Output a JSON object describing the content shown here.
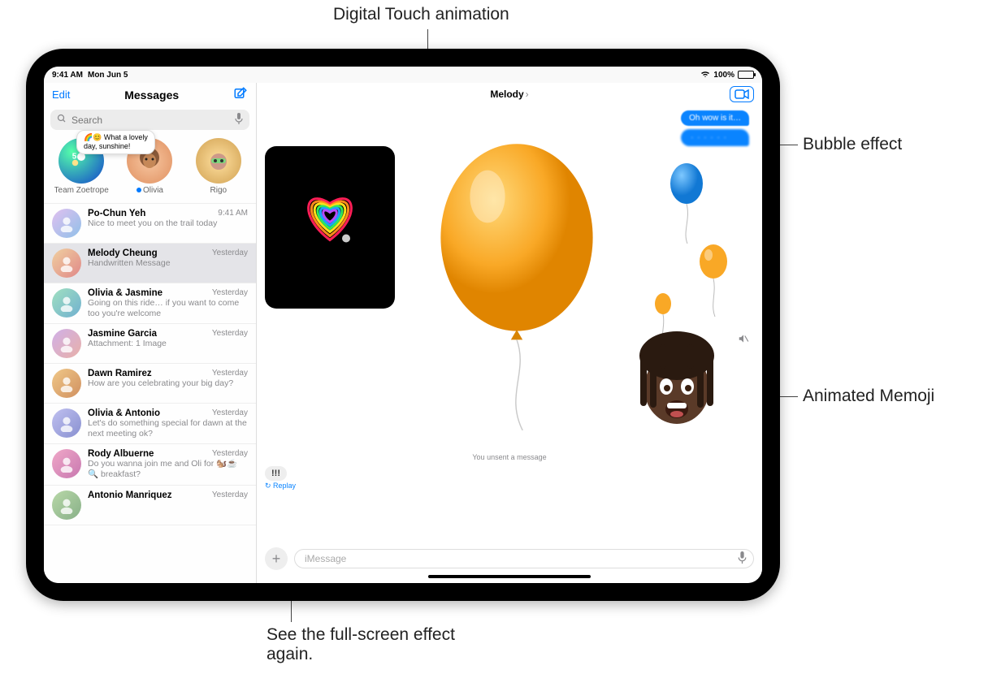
{
  "annotations": {
    "digital_touch": "Digital Touch animation",
    "bubble_effect": "Bubble effect",
    "animated_memoji": "Animated Memoji",
    "replay_hint": "See the full-screen effect again."
  },
  "statusbar": {
    "time": "9:41 AM",
    "date": "Mon Jun 5",
    "battery": "100%"
  },
  "sidebar": {
    "edit": "Edit",
    "title": "Messages",
    "search_placeholder": "Search",
    "tooltip_line1": "🌈😊 What a lovely",
    "tooltip_line2": "day, sunshine!",
    "pinned": [
      {
        "name": "Team Zoetrope"
      },
      {
        "name": "Olivia",
        "unread": true
      },
      {
        "name": "Rigo"
      }
    ],
    "conversations": [
      {
        "name": "Po-Chun Yeh",
        "time": "9:41 AM",
        "preview": "Nice to meet you on the trail today"
      },
      {
        "name": "Melody Cheung",
        "time": "Yesterday",
        "preview": "Handwritten Message",
        "selected": true
      },
      {
        "name": "Olivia & Jasmine",
        "time": "Yesterday",
        "preview": "Going on this ride… if you want to come too you're welcome"
      },
      {
        "name": "Jasmine Garcia",
        "time": "Yesterday",
        "preview": "Attachment: 1 Image"
      },
      {
        "name": "Dawn Ramirez",
        "time": "Yesterday",
        "preview": "How are you celebrating your big day?"
      },
      {
        "name": "Olivia & Antonio",
        "time": "Yesterday",
        "preview": "Let's do something special for dawn at the next meeting ok?"
      },
      {
        "name": "Rody Albuerne",
        "time": "Yesterday",
        "preview": "Do you wanna join me and Oli for 🐿️☕🔍 breakfast?"
      },
      {
        "name": "Antonio Manriquez",
        "time": "Yesterday",
        "preview": ""
      }
    ]
  },
  "content": {
    "contact": "Melody",
    "bubble1": "Oh wow is it…",
    "bubble2": "· · · · · ·",
    "unsent": "You unsent a message",
    "tapback": "!!!",
    "replay": "↻ Replay",
    "input_placeholder": "iMessage"
  }
}
